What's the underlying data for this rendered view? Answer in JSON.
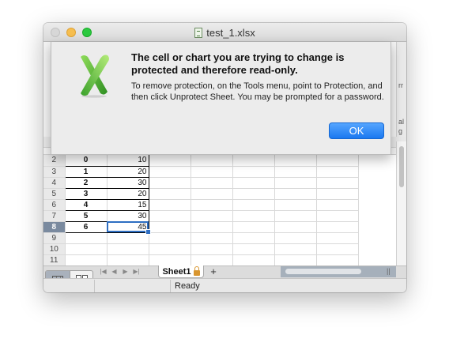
{
  "window": {
    "title": "test_1.xlsx"
  },
  "toolbar_fragments": [
    "rr",
    "al",
    "g"
  ],
  "dialog": {
    "heading": "The cell or chart you are trying to change is protected and therefore read-only.",
    "message": "To remove protection, on the Tools menu, point to Protection, and then click Unprotect Sheet. You may be prompted for a password.",
    "ok_label": "OK",
    "accent_color": "#1a78f0"
  },
  "sheet": {
    "rows": [
      {
        "num": "2",
        "a": "0",
        "b": "10"
      },
      {
        "num": "3",
        "a": "1",
        "b": "20"
      },
      {
        "num": "4",
        "a": "2",
        "b": "30"
      },
      {
        "num": "5",
        "a": "3",
        "b": "20"
      },
      {
        "num": "6",
        "a": "4",
        "b": "15"
      },
      {
        "num": "7",
        "a": "5",
        "b": "30"
      },
      {
        "num": "8",
        "a": "6",
        "b": "45"
      },
      {
        "num": "9",
        "a": "",
        "b": ""
      },
      {
        "num": "10",
        "a": "",
        "b": ""
      },
      {
        "num": "11",
        "a": "",
        "b": ""
      }
    ],
    "selected_row": "8",
    "active_cell": "B8"
  },
  "tabs": {
    "sheet_name": "Sheet1",
    "add_label": "+",
    "nav": [
      "|◀",
      "◀",
      "▶",
      "▶|"
    ]
  },
  "status": {
    "text": "Ready"
  },
  "icons": {
    "app": "excel-x-icon",
    "lock": "lock-icon",
    "document": "document-icon"
  }
}
